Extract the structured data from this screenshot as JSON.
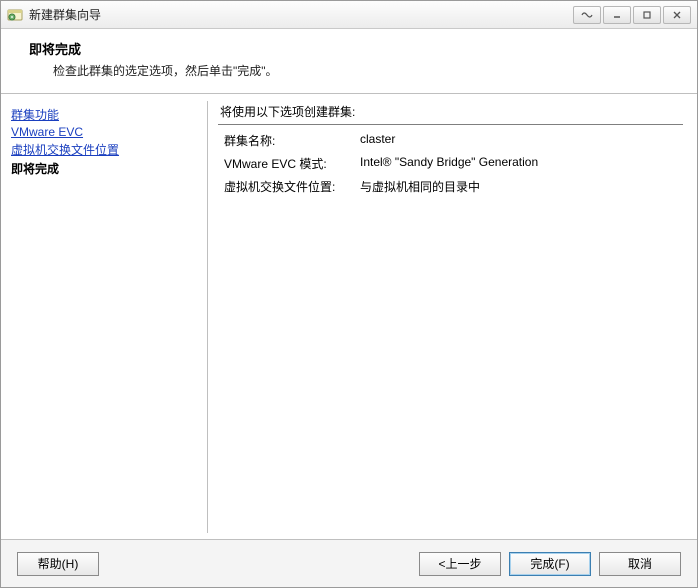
{
  "window": {
    "title": "新建群集向导"
  },
  "header": {
    "title": "即将完成",
    "subtitle": "检查此群集的选定选项，然后单击\"完成\"。"
  },
  "sidebar": {
    "items": [
      {
        "label": "群集功能",
        "link": true
      },
      {
        "label": "VMware EVC",
        "link": true
      },
      {
        "label": "虚拟机交换文件位置",
        "link": true
      },
      {
        "label": "即将完成",
        "link": false
      }
    ]
  },
  "content": {
    "heading": "将使用以下选项创建群集:",
    "rows": [
      {
        "k": "群集名称:",
        "v": "claster"
      },
      {
        "k": "VMware EVC 模式:",
        "v": "Intel® \"Sandy Bridge\" Generation"
      },
      {
        "k": "虚拟机交换文件位置:",
        "v": "与虚拟机相同的目录中"
      }
    ]
  },
  "footer": {
    "help": "帮助(H)",
    "back": "<上一步",
    "finish": "完成(F)",
    "cancel": "取消"
  }
}
